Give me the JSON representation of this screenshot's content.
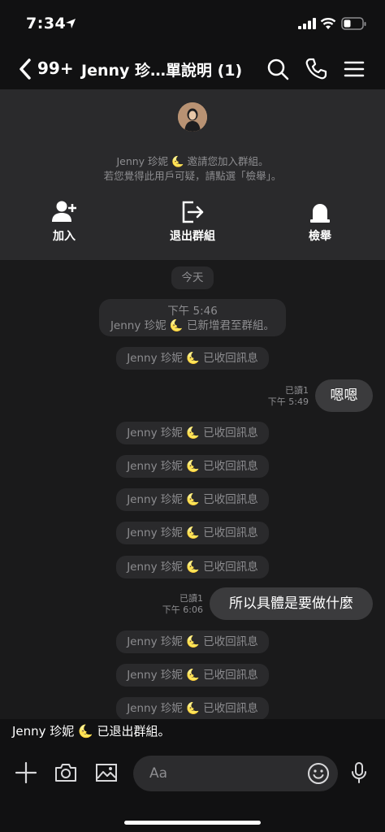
{
  "status_bar": {
    "time": "7:34"
  },
  "nav": {
    "count": "99+",
    "title": "Jenny 珍…單說明 (1)"
  },
  "invite": {
    "line1": "Jenny 珍妮 🌜 邀請您加入群組。",
    "line2": "若您覺得此用戶可疑，請點選「檢舉」。",
    "actions": {
      "join": "加入",
      "leave": "退出群組",
      "report": "檢舉"
    }
  },
  "chat": {
    "date_chip": "今天",
    "system_time": "下午 5:46",
    "system_added": "Jenny 珍妮 🌜 已新增君至群組。",
    "recalled": "Jenny 珍妮 🌜 已收回訊息",
    "messages": [
      {
        "text": "嗯嗯",
        "read": "已讀1",
        "time": "下午 5:49"
      },
      {
        "text": "所以具體是要做什麼",
        "read": "已讀1",
        "time": "下午 6:06"
      }
    ]
  },
  "system_notice": "Jenny 珍妮 🌜 已退出群組。",
  "composer": {
    "placeholder": "Aa"
  },
  "colors": {
    "background": "#1a1a1b",
    "panel": "#2a2a2c",
    "bubble": "#3b3b3d",
    "moon": "#e3b553"
  }
}
